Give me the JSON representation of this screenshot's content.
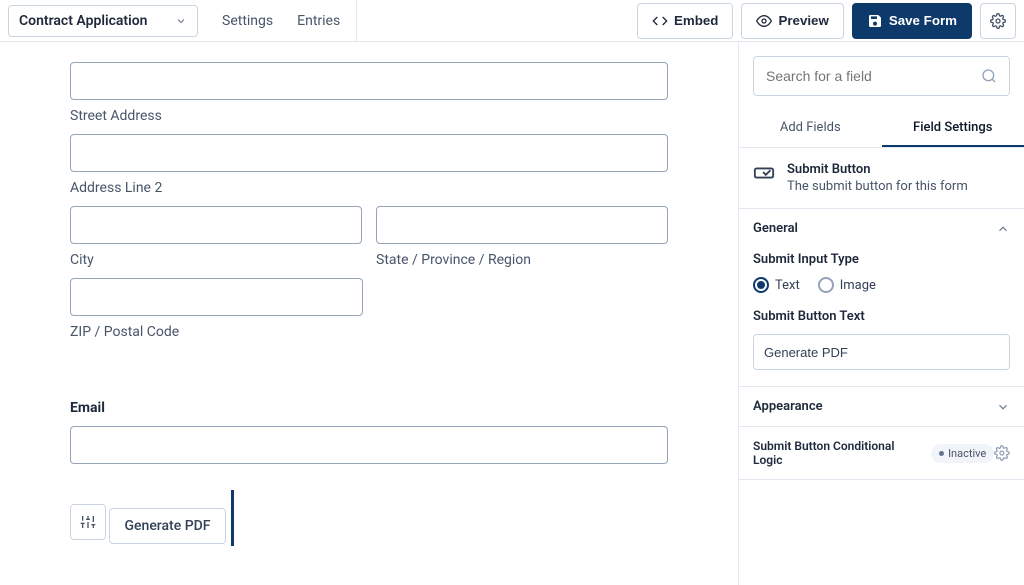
{
  "topbar": {
    "form_name": "Contract Application",
    "nav_settings": "Settings",
    "nav_entries": "Entries",
    "embed": "Embed",
    "preview": "Preview",
    "save": "Save Form"
  },
  "form": {
    "street_label": "Street Address",
    "addr2_label": "Address Line 2",
    "city_label": "City",
    "state_label": "State / Province / Region",
    "zip_label": "ZIP / Postal Code",
    "email_heading": "Email",
    "generate_btn": "Generate PDF"
  },
  "sidebar": {
    "search_placeholder": "Search for a field",
    "tab_add": "Add Fields",
    "tab_settings": "Field Settings",
    "field_title": "Submit Button",
    "field_desc": "The submit button for this form",
    "panel_general": "General",
    "panel_appearance": "Appearance",
    "submit_type_label": "Submit Input Type",
    "radio_text": "Text",
    "radio_image": "Image",
    "submit_text_label": "Submit Button Text",
    "submit_text_value": "Generate PDF",
    "logic_label": "Submit Button Conditional Logic",
    "logic_badge": "Inactive"
  }
}
